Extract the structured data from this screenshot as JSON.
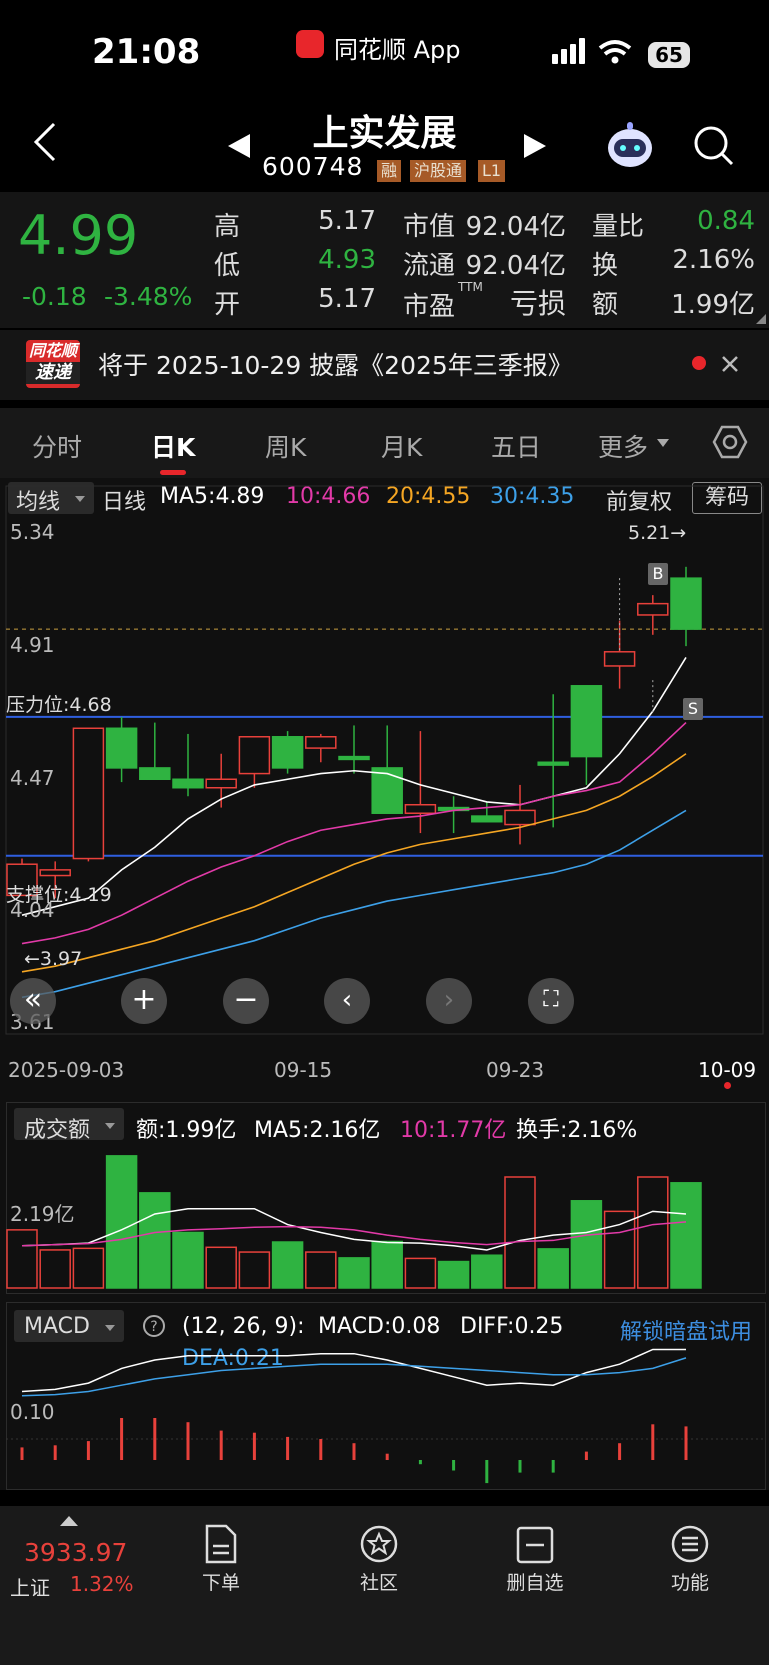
{
  "status_bar": {
    "time": "21:08",
    "app_name": "同花顺 App",
    "battery": "65"
  },
  "header": {
    "title": "上实发展",
    "code": "600748",
    "tags": [
      "融",
      "沪股通",
      "L1"
    ]
  },
  "quote": {
    "price": "4.99",
    "change": "-0.18",
    "change_pct": "-3.48%",
    "high_label": "高",
    "high": "5.17",
    "low_label": "低",
    "low": "4.93",
    "open_label": "开",
    "open": "5.17",
    "mcap_label": "市值",
    "mcap": "92.04亿",
    "float_label": "流通",
    "float": "92.04亿",
    "pe_label": "市盈",
    "pe_sup": "TTM",
    "pe": "亏损",
    "vr_label": "量比",
    "vr": "0.84",
    "turn_label": "换",
    "turn": "2.16%",
    "amt_label": "额",
    "amt": "1.99亿"
  },
  "notice": {
    "logo_top": "同花顺",
    "logo_bottom": "速递",
    "text": "将于 2025-10-29 披露《2025年三季报》"
  },
  "tabs": [
    "分时",
    "日K",
    "周K",
    "月K",
    "五日",
    "更多"
  ],
  "active_tab": "日K",
  "ma_bar": {
    "selector": "均线",
    "period": "日线",
    "ma5": "MA5:4.89",
    "ma10": "10:4.66",
    "ma20": "20:4.55",
    "ma30": "30:4.35",
    "adjust": "前复权",
    "chip": "筹码"
  },
  "price_axis": {
    "t1": "5.34",
    "t2": "4.91",
    "t3": "4.47",
    "t4": "4.04",
    "t5": "3.61"
  },
  "annotations": {
    "high_mark": "5.21→",
    "low_mark": "←3.97",
    "resistance": "压力位:4.68",
    "support": "支撑位:4.19",
    "buy": "B",
    "sell": "S"
  },
  "dates": {
    "d1": "2025-09-03",
    "d2": "09-15",
    "d3": "09-23",
    "d4": "10-09"
  },
  "volume": {
    "selector": "成交额",
    "amt": "额:1.99亿",
    "ma5": "MA5:2.16亿",
    "ma10": "10:1.77亿",
    "turnover": "换手:2.16%",
    "axis": "2.19亿"
  },
  "macd": {
    "selector": "MACD",
    "params": "(12, 26, 9):",
    "macd": "MACD:0.08",
    "diff": "DIFF:0.25",
    "dea": "DEA:0.21",
    "unlock": "解锁暗盘试用",
    "axis": "0.10"
  },
  "bottom": {
    "index_value": "3933.97",
    "index_name": "上证",
    "index_pct": "1.32%",
    "order": "下单",
    "community": "社区",
    "remove": "删自选",
    "functions": "功能"
  },
  "colors": {
    "up": "#e8413b",
    "down": "#2fb341",
    "ma5": "#ffffff",
    "ma10": "#e23aa8",
    "ma20": "#f5a623",
    "ma30": "#3da0e8",
    "level": "#2f5fe0"
  },
  "chart_data": {
    "type": "candlestick",
    "x": [
      "2025-09-03",
      "09-04",
      "09-05",
      "09-08",
      "09-09",
      "09-10",
      "09-11",
      "09-12",
      "09-15",
      "09-16",
      "09-17",
      "09-18",
      "09-19",
      "09-22",
      "09-23",
      "09-24",
      "09-25",
      "09-26",
      "09-29",
      "09-30",
      "10-09"
    ],
    "open": [
      4.05,
      4.12,
      4.18,
      4.64,
      4.5,
      4.46,
      4.43,
      4.48,
      4.61,
      4.57,
      4.54,
      4.5,
      4.34,
      4.36,
      4.33,
      4.3,
      4.52,
      4.79,
      4.86,
      5.04,
      5.17
    ],
    "high": [
      4.18,
      4.17,
      4.3,
      4.68,
      4.66,
      4.62,
      4.55,
      4.55,
      4.63,
      4.62,
      4.65,
      4.65,
      4.63,
      4.4,
      4.38,
      4.44,
      4.76,
      4.66,
      5.02,
      5.11,
      5.21
    ],
    "close": [
      4.16,
      4.14,
      4.64,
      4.5,
      4.46,
      4.43,
      4.46,
      4.61,
      4.5,
      4.61,
      4.53,
      4.34,
      4.37,
      4.35,
      4.31,
      4.35,
      4.51,
      4.54,
      4.91,
      5.08,
      4.99
    ],
    "low": [
      4.05,
      4.04,
      4.17,
      4.45,
      4.46,
      4.4,
      4.36,
      4.43,
      4.48,
      4.52,
      4.48,
      4.39,
      4.27,
      4.27,
      4.31,
      4.23,
      4.29,
      4.44,
      4.78,
      4.97,
      4.93
    ],
    "ma5": [
      3.98,
      4.01,
      4.04,
      4.14,
      4.22,
      4.32,
      4.39,
      4.44,
      4.46,
      4.48,
      4.49,
      4.48,
      4.44,
      4.41,
      4.38,
      4.37,
      4.4,
      4.43,
      4.55,
      4.7,
      4.89
    ],
    "ma10": [
      3.88,
      3.9,
      3.93,
      3.98,
      4.04,
      4.1,
      4.15,
      4.19,
      4.24,
      4.28,
      4.3,
      4.32,
      4.33,
      4.35,
      4.36,
      4.37,
      4.4,
      4.42,
      4.45,
      4.55,
      4.66
    ],
    "ma20": [
      3.78,
      3.8,
      3.83,
      3.86,
      3.89,
      3.93,
      3.97,
      4.01,
      4.06,
      4.11,
      4.16,
      4.2,
      4.23,
      4.25,
      4.27,
      4.29,
      4.32,
      4.35,
      4.4,
      4.47,
      4.55
    ],
    "ma30": [
      3.69,
      3.71,
      3.74,
      3.77,
      3.8,
      3.83,
      3.86,
      3.89,
      3.93,
      3.97,
      4.0,
      4.03,
      4.05,
      4.07,
      4.09,
      4.11,
      4.13,
      4.16,
      4.21,
      4.28,
      4.35
    ],
    "ylim": [
      3.61,
      5.34
    ],
    "levels": {
      "resistance": 4.68,
      "support": 4.19
    },
    "amount": [
      1.1,
      0.72,
      0.75,
      2.5,
      1.8,
      1.05,
      0.77,
      0.68,
      0.87,
      0.68,
      0.57,
      0.88,
      0.56,
      0.5,
      0.62,
      2.1,
      0.74,
      1.65,
      1.45,
      2.1,
      1.99
    ],
    "amount_ylim": [
      0,
      2.8
    ],
    "macd_bar": [
      0.06,
      0.07,
      0.09,
      0.2,
      0.2,
      0.18,
      0.14,
      0.13,
      0.11,
      0.1,
      0.08,
      0.03,
      -0.02,
      -0.05,
      -0.11,
      -0.06,
      -0.06,
      0.04,
      0.08,
      0.17,
      0.16
    ],
    "diff": [
      0.05,
      0.06,
      0.09,
      0.16,
      0.2,
      0.22,
      0.22,
      0.22,
      0.22,
      0.23,
      0.23,
      0.2,
      0.16,
      0.12,
      0.08,
      0.09,
      0.08,
      0.14,
      0.18,
      0.25,
      0.25
    ],
    "dea": [
      0.03,
      0.035,
      0.05,
      0.08,
      0.11,
      0.13,
      0.15,
      0.16,
      0.17,
      0.18,
      0.18,
      0.18,
      0.17,
      0.16,
      0.15,
      0.14,
      0.13,
      0.13,
      0.14,
      0.16,
      0.21
    ],
    "macd_ylim": [
      -0.12,
      0.3
    ]
  }
}
